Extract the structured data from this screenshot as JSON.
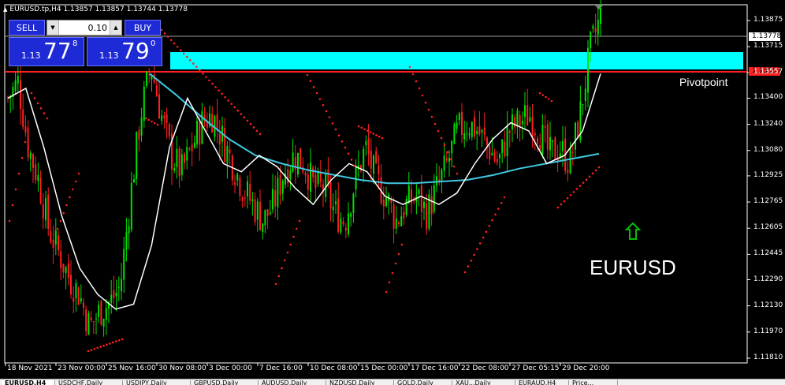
{
  "window": {
    "title": "EURUSD.tp,H4  1.13857 1.13857 1.13744 1.13778"
  },
  "trade_panel": {
    "sell_label": "SELL",
    "buy_label": "BUY",
    "lot_value": "0.10",
    "sell_price": {
      "prefix": "1.13",
      "big": "77",
      "sup": "8"
    },
    "buy_price": {
      "prefix": "1.13",
      "big": "79",
      "sup": "0"
    }
  },
  "annotations": {
    "pivot_label": "Pivotpoint",
    "symbol_label": "EURUSD",
    "current_price_tag": "1.13778",
    "pivot_price_tag": "1.13557"
  },
  "colors": {
    "background": "#000000",
    "bull_candle": "#00e000",
    "bear_candle": "#ff2020",
    "pivot_zone": "#00ffff",
    "pivot_line": "#ff2020",
    "ma_slow": "#40c8e0",
    "ma_fast": "#ffffff",
    "sar_dots": "#ff2020",
    "arrow": "#00c000"
  },
  "icons": {
    "up_arrow": "up-arrow-icon",
    "lot_down": "triangle-down-icon",
    "lot_up": "triangle-up-icon"
  },
  "chart_data": {
    "type": "candlestick",
    "symbol": "EURUSD.tp",
    "timeframe": "H4",
    "ohlc_header": {
      "open": 1.13857,
      "high": 1.13857,
      "low": 1.13744,
      "close": 1.13778
    },
    "current_price": 1.13778,
    "pivot_level": 1.13557,
    "pivot_zone": [
      1.13557,
      1.13715
    ],
    "ylim": [
      1.118,
      1.1395
    ],
    "y_ticks": [
      "1.13875",
      "1.13715",
      "1.13557",
      "1.13400",
      "1.13240",
      "1.13080",
      "1.12925",
      "1.12765",
      "1.12605",
      "1.12445",
      "1.12290",
      "1.12130",
      "1.11970",
      "1.11810"
    ],
    "x_ticks": [
      "18 Nov 2021",
      "23 Nov 00:00",
      "25 Nov 16:00",
      "30 Nov 08:00",
      "3 Dec 00:00",
      "7 Dec 16:00",
      "10 Dec 08:00",
      "15 Dec 00:00",
      "17 Dec 16:00",
      "22 Dec 08:00",
      "27 Dec 05:15",
      "29 Dec 20:00"
    ],
    "close_path": [
      1.134,
      1.135,
      1.131,
      1.129,
      1.126,
      1.1245,
      1.123,
      1.122,
      1.12,
      1.121,
      1.1215,
      1.1225,
      1.128,
      1.133,
      1.136,
      1.133,
      1.1305,
      1.1295,
      1.131,
      1.1325,
      1.133,
      1.1315,
      1.13,
      1.1285,
      1.1275,
      1.1265,
      1.1275,
      1.1295,
      1.1305,
      1.13,
      1.1285,
      1.1285,
      1.127,
      1.1265,
      1.129,
      1.131,
      1.129,
      1.128,
      1.1265,
      1.1275,
      1.128,
      1.127,
      1.1285,
      1.13,
      1.132,
      1.1325,
      1.132,
      1.131,
      1.13,
      1.132,
      1.1325,
      1.133,
      1.132,
      1.1305,
      1.131,
      1.13,
      1.133,
      1.137,
      1.139
    ],
    "ma_slow": [
      1.1355,
      1.1342,
      1.1328,
      1.1315,
      1.1305,
      1.13,
      1.1296,
      1.1293,
      1.129,
      1.1288,
      1.1288,
      1.1289,
      1.129,
      1.1293,
      1.1297,
      1.13,
      1.1303,
      1.1306
    ],
    "ma_fast": [
      1.134,
      1.1346,
      1.131,
      1.1268,
      1.1236,
      1.122,
      1.1211,
      1.1214,
      1.125,
      1.131,
      1.134,
      1.132,
      1.13,
      1.1295,
      1.1305,
      1.1298,
      1.1285,
      1.1275,
      1.129,
      1.13,
      1.1295,
      1.128,
      1.1275,
      1.128,
      1.1275,
      1.1282,
      1.13,
      1.1315,
      1.1325,
      1.132,
      1.13,
      1.1305,
      1.132,
      1.1355
    ]
  },
  "tabs": [
    "EURUSD,H4",
    "USDCHF,Daily",
    "USDJPY,Daily",
    "GBPUSD,Daily",
    "AUDUSD,Daily",
    "NZDUSD,Daily",
    "GOLD,Daily",
    "XAU...Daily",
    "EURAUD,H4",
    "Price..."
  ]
}
